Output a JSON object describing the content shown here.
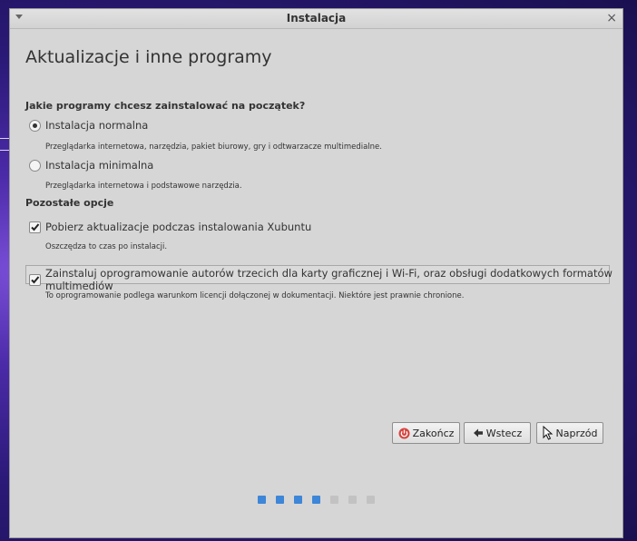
{
  "window": {
    "title": "Instalacja"
  },
  "page": {
    "heading": "Aktualizacje i inne programy"
  },
  "install_question": "Jakie programy chcesz zainstalować na początek?",
  "install_options": [
    {
      "label": "Instalacja normalna",
      "description": "Przeglądarka internetowa, narzędzia, pakiet biurowy, gry i odtwarzacze multimedialne.",
      "selected": true
    },
    {
      "label": "Instalacja minimalna",
      "description": "Przeglądarka internetowa i podstawowe narzędzia.",
      "selected": false
    }
  ],
  "other_options": {
    "heading": "Pozostałe opcje",
    "updates": {
      "label": "Pobierz aktualizacje podczas instalowania Xubuntu",
      "description": "Oszczędza to czas po instalacji.",
      "checked": true
    },
    "third_party": {
      "label": "Zainstaluj oprogramowanie autorów trzecich dla karty graficznej i Wi-Fi, oraz obsługi dodatkowych formatów multimediów",
      "description": "To oprogramowanie podlega warunkom licencji dołączonej w dokumentacji. Niektóre jest prawnie chronione.",
      "checked": true
    }
  },
  "buttons": {
    "quit": "Zakończ",
    "back": "Wstecz",
    "next": "Naprzód"
  },
  "progress": {
    "total_steps": 7,
    "completed_steps": 4,
    "active_color": "#3d86d8",
    "inactive_color": "#c2c2c2"
  },
  "colors": {
    "quit_icon": "#d64541"
  }
}
